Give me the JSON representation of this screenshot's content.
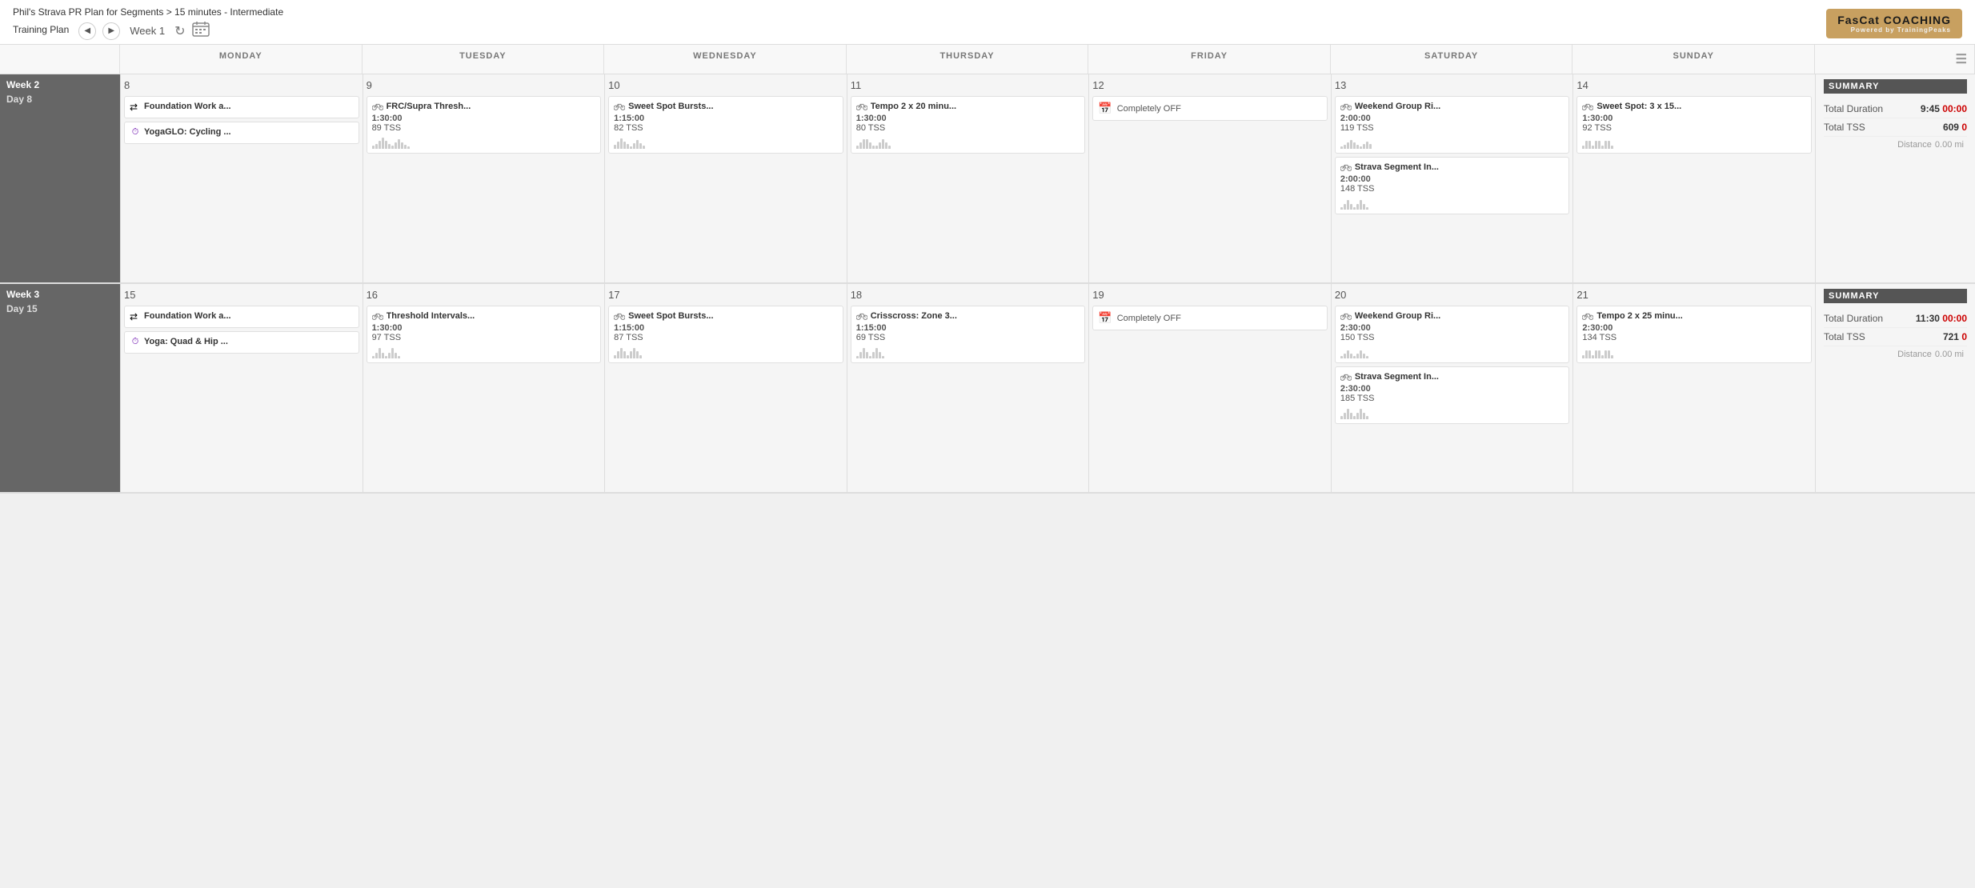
{
  "header": {
    "plan_subtitle": "Phil's Strava PR Plan for Segments > 15 minutes - Intermediate",
    "plan_title": "Training Plan",
    "week_label": "Week 1",
    "brand": "FasCat COACHING",
    "brand_powered": "Powered by TrainingPeaks"
  },
  "calendar": {
    "days": [
      "MONDAY",
      "TUESDAY",
      "WEDNESDAY",
      "THURSDAY",
      "FRIDAY",
      "SATURDAY",
      "SUNDAY"
    ]
  },
  "week2": {
    "label": "Week 2",
    "day_start": "Day 8",
    "days": [
      {
        "num": "8",
        "workouts": [
          {
            "type": "bike",
            "title": "Foundation Work a...",
            "duration": "",
            "tss": "",
            "has_graph": false
          },
          {
            "type": "yoga",
            "title": "YogaGLO: Cycling ...",
            "duration": "",
            "tss": "",
            "has_graph": false
          }
        ]
      },
      {
        "num": "9",
        "workouts": [
          {
            "type": "bike",
            "title": "FRC/Supra Thresh...",
            "duration": "1:30:00",
            "tss": "89 TSS",
            "has_graph": true
          }
        ]
      },
      {
        "num": "10",
        "workouts": [
          {
            "type": "bike",
            "title": "Sweet Spot Bursts...",
            "duration": "1:15:00",
            "tss": "82 TSS",
            "has_graph": true
          }
        ]
      },
      {
        "num": "11",
        "workouts": [
          {
            "type": "bike",
            "title": "Tempo 2 x 20 minu...",
            "duration": "1:30:00",
            "tss": "80 TSS",
            "has_graph": true
          }
        ]
      },
      {
        "num": "12",
        "workouts": [
          {
            "type": "off",
            "title": "Completely OFF",
            "duration": "",
            "tss": "",
            "has_graph": false
          }
        ]
      },
      {
        "num": "13",
        "workouts": [
          {
            "type": "bike",
            "title": "Weekend Group Ri...",
            "duration": "2:00:00",
            "tss": "119 TSS",
            "has_graph": true
          },
          {
            "type": "bike",
            "title": "Strava Segment In...",
            "duration": "2:00:00",
            "tss": "148 TSS",
            "has_graph": true
          }
        ]
      },
      {
        "num": "14",
        "workouts": [
          {
            "type": "bike",
            "title": "Sweet Spot: 3 x 15...",
            "duration": "1:30:00",
            "tss": "92 TSS",
            "has_graph": true
          }
        ]
      }
    ],
    "summary": {
      "title": "SUMMARY",
      "total_duration_label": "Total Duration",
      "total_duration_value": "9:45",
      "total_duration_zero": "00:00",
      "total_tss_label": "Total TSS",
      "total_tss_value": "609",
      "total_tss_zero": "0",
      "distance_label": "Distance",
      "distance_value": "0.00 mi"
    }
  },
  "week3": {
    "label": "Week 3",
    "day_start": "Day 15",
    "days": [
      {
        "num": "15",
        "workouts": [
          {
            "type": "bike",
            "title": "Foundation Work a...",
            "duration": "",
            "tss": "",
            "has_graph": false
          },
          {
            "type": "yoga",
            "title": "Yoga: Quad & Hip ...",
            "duration": "",
            "tss": "",
            "has_graph": false
          }
        ]
      },
      {
        "num": "16",
        "workouts": [
          {
            "type": "bike",
            "title": "Threshold Intervals...",
            "duration": "1:30:00",
            "tss": "97 TSS",
            "has_graph": true
          }
        ]
      },
      {
        "num": "17",
        "workouts": [
          {
            "type": "bike",
            "title": "Sweet Spot Bursts...",
            "duration": "1:15:00",
            "tss": "87 TSS",
            "has_graph": true
          }
        ]
      },
      {
        "num": "18",
        "workouts": [
          {
            "type": "bike",
            "title": "Crisscross: Zone 3...",
            "duration": "1:15:00",
            "tss": "69 TSS",
            "has_graph": true
          }
        ]
      },
      {
        "num": "19",
        "workouts": [
          {
            "type": "off",
            "title": "Completely OFF",
            "duration": "",
            "tss": "",
            "has_graph": false
          }
        ]
      },
      {
        "num": "20",
        "workouts": [
          {
            "type": "bike",
            "title": "Weekend Group Ri...",
            "duration": "2:30:00",
            "tss": "150 TSS",
            "has_graph": true
          },
          {
            "type": "bike",
            "title": "Strava Segment In...",
            "duration": "2:30:00",
            "tss": "185 TSS",
            "has_graph": true
          }
        ]
      },
      {
        "num": "21",
        "workouts": [
          {
            "type": "bike",
            "title": "Tempo 2 x 25 minu...",
            "duration": "2:30:00",
            "tss": "134 TSS",
            "has_graph": true
          }
        ]
      }
    ],
    "summary": {
      "title": "SUMMARY",
      "total_duration_label": "Total Duration",
      "total_duration_value": "11:30",
      "total_duration_zero": "00:00",
      "total_tss_label": "Total TSS",
      "total_tss_value": "721",
      "total_tss_zero": "0",
      "distance_label": "Distance",
      "distance_value": "0.00 mi"
    }
  }
}
